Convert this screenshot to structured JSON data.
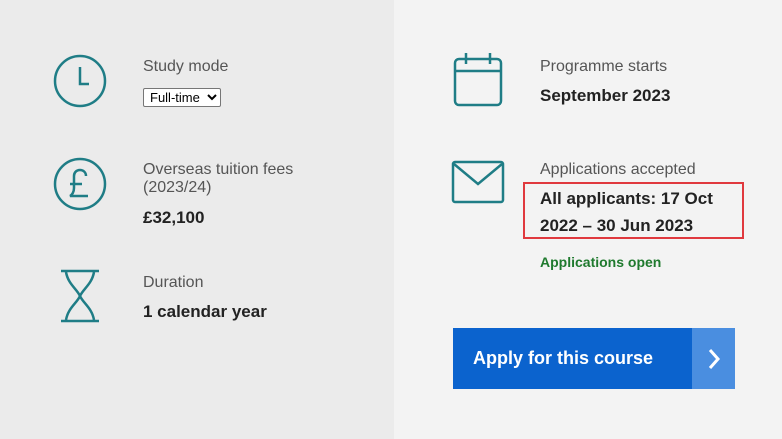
{
  "colors": {
    "icon_teal": "#1f7d86",
    "left_background": "#ebebeb",
    "right_background": "#f3f3f3",
    "button_blue": "#0b63ce",
    "status_green": "#1f7a2e",
    "highlight_red": "#e0393e"
  },
  "study_mode": {
    "icon": "clock-icon",
    "label": "Study mode",
    "selected": "Full-time",
    "options": [
      "Full-time"
    ]
  },
  "fees": {
    "icon": "pound-icon",
    "label_line1": "Overseas tuition fees",
    "label_line2": "(2023/24)",
    "value": "£32,100"
  },
  "duration": {
    "icon": "hourglass-icon",
    "label": "Duration",
    "value": "1 calendar year"
  },
  "programme_start": {
    "icon": "calendar-icon",
    "label": "Programme starts",
    "value": "September 2023"
  },
  "applications": {
    "icon": "envelope-icon",
    "label": "Applications accepted",
    "value_line1": "All applicants: 17 Oct",
    "value_line2": "2022 – 30 Jun 2023",
    "status": "Applications open"
  },
  "apply_button": {
    "label": "Apply for this course",
    "icon": "chevron-right-icon"
  }
}
